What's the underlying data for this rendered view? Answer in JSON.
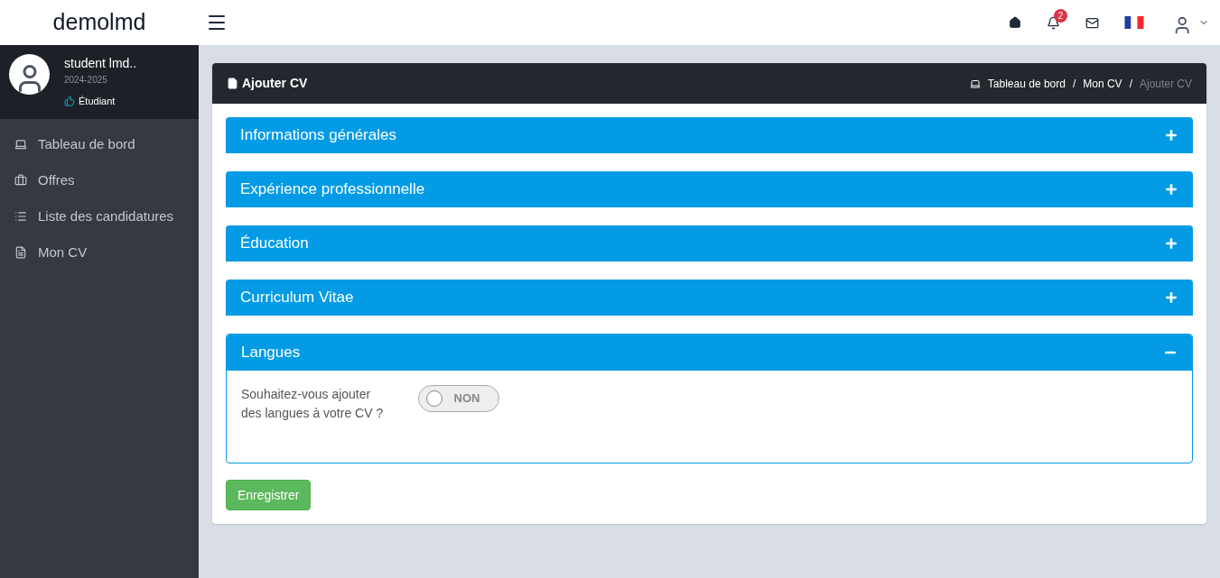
{
  "brand": "demolmd",
  "topbar": {
    "notification_count": "2"
  },
  "user": {
    "name": "student lmd..",
    "year": "2024-2025",
    "role": "Étudiant"
  },
  "sidebar": {
    "items": [
      {
        "label": "Tableau de bord"
      },
      {
        "label": "Offres"
      },
      {
        "label": "Liste des candidatures"
      },
      {
        "label": "Mon CV"
      }
    ]
  },
  "page": {
    "title": "Ajouter CV",
    "breadcrumb_separator": "/",
    "breadcrumb": [
      {
        "label": "Tableau de bord",
        "current": false
      },
      {
        "label": "Mon CV",
        "current": false
      },
      {
        "label": "Ajouter CV",
        "current": true
      }
    ]
  },
  "sections": [
    {
      "title": "Informations générales",
      "expanded": false
    },
    {
      "title": "Expérience professionnelle",
      "expanded": false
    },
    {
      "title": "Éducation",
      "expanded": false
    },
    {
      "title": "Curriculum Vitae",
      "expanded": false
    },
    {
      "title": "Langues",
      "expanded": true,
      "question": "Souhaitez-vous ajouter des langues à votre CV ?",
      "toggle": {
        "on": false,
        "label": "NON"
      }
    }
  ],
  "save_button": "Enregistrer"
}
